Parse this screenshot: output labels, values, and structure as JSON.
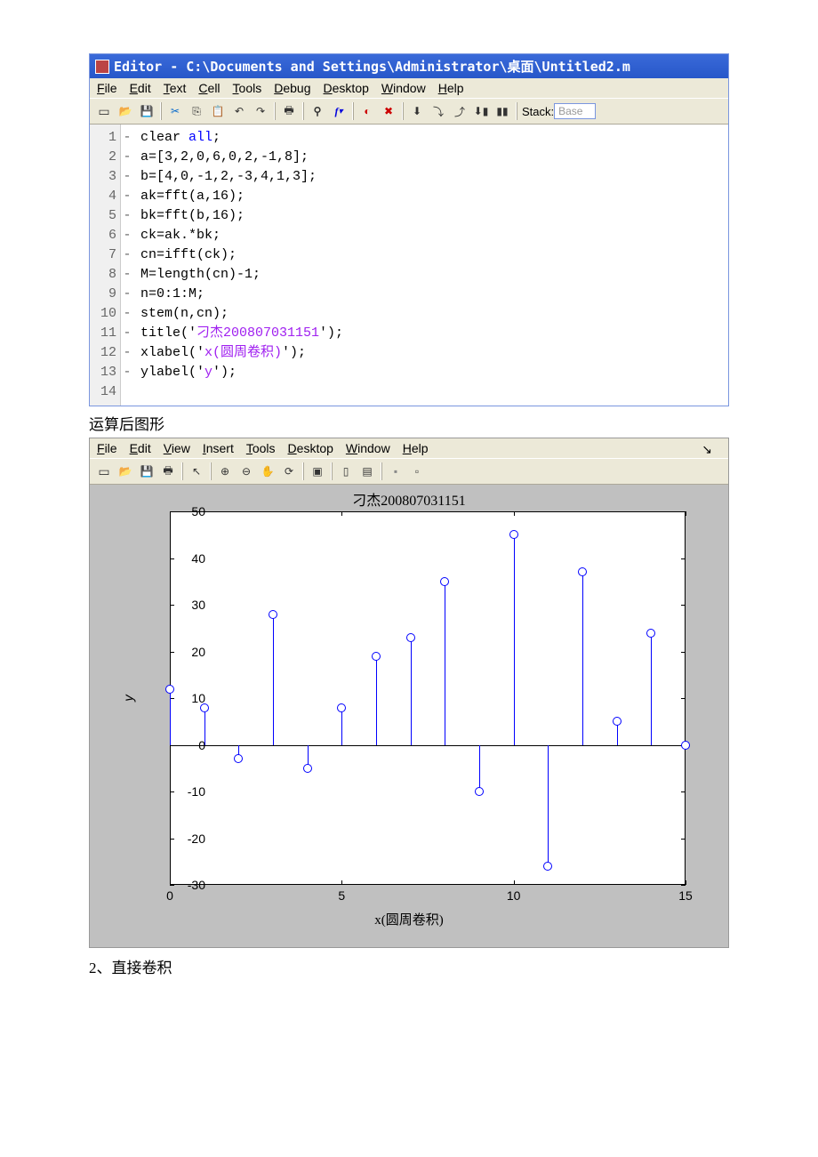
{
  "editor": {
    "title": "Editor - C:\\Documents and Settings\\Administrator\\桌面\\Untitled2.m",
    "menus": [
      "File",
      "Edit",
      "Text",
      "Cell",
      "Tools",
      "Debug",
      "Desktop",
      "Window",
      "Help"
    ],
    "stack_label": "Stack:",
    "stack_value": "Base",
    "code": [
      {
        "n": "1",
        "d": "-",
        "t": "clear all;"
      },
      {
        "n": "2",
        "d": "-",
        "t": "a=[3,2,0,6,0,2,-1,8];"
      },
      {
        "n": "3",
        "d": "-",
        "t": "b=[4,0,-1,2,-3,4,1,3];"
      },
      {
        "n": "4",
        "d": "-",
        "t": "ak=fft(a,16);"
      },
      {
        "n": "5",
        "d": "-",
        "t": "bk=fft(b,16);"
      },
      {
        "n": "6",
        "d": "-",
        "t": "ck=ak.*bk;"
      },
      {
        "n": "7",
        "d": "-",
        "t": "cn=ifft(ck);"
      },
      {
        "n": "8",
        "d": "-",
        "t": "M=length(cn)-1;"
      },
      {
        "n": "9",
        "d": "-",
        "t": "n=0:1:M;"
      },
      {
        "n": "10",
        "d": "-",
        "t": "stem(n,cn);"
      },
      {
        "n": "11",
        "d": "-",
        "t": "title('刁杰200807031151');"
      },
      {
        "n": "12",
        "d": "-",
        "t": "xlabel('x(圆周卷积)');"
      },
      {
        "n": "13",
        "d": "-",
        "t": "ylabel('y');"
      },
      {
        "n": "14",
        "d": "",
        "t": ""
      }
    ]
  },
  "caption1": "运算后图形",
  "figure": {
    "menus": [
      "File",
      "Edit",
      "View",
      "Insert",
      "Tools",
      "Desktop",
      "Window",
      "Help"
    ]
  },
  "chart_data": {
    "type": "stem",
    "title": "刁杰200807031151",
    "xlabel": "x(圆周卷积)",
    "ylabel": "y",
    "xlim": [
      0,
      15
    ],
    "ylim": [
      -30,
      50
    ],
    "xticks": [
      0,
      5,
      10,
      15
    ],
    "yticks": [
      -30,
      -20,
      -10,
      0,
      10,
      20,
      30,
      40,
      50
    ],
    "x": [
      0,
      1,
      2,
      3,
      4,
      5,
      6,
      7,
      8,
      9,
      10,
      11,
      12,
      13,
      14,
      15
    ],
    "y": [
      12,
      8,
      -3,
      28,
      -5,
      8,
      19,
      23,
      35,
      -10,
      45,
      -26,
      37,
      5,
      24,
      0
    ]
  },
  "section2": "2、直接卷积"
}
